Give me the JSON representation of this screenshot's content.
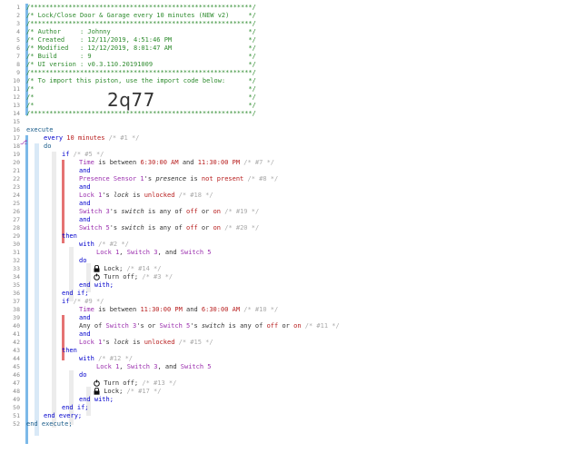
{
  "import_code": "2q77",
  "header_lines": [
    "/**********************************************************/",
    "/* Lock/Close Door & Garage every 10 minutes (NEW v2)     */",
    "/**********************************************************/",
    "/* Author     : Johnny                                    */",
    "/* Created    : 12/11/2019, 4:51:46 PM                    */",
    "/* Modified   : 12/12/2019, 8:01:47 AM                    */",
    "/* Build      : 9                                         */",
    "/* UI version : v0.3.110.20191009                         */",
    "/**********************************************************/",
    "/* To import this piston, use the import code below:      */",
    "/*                                                        */",
    "/*                                                        */",
    "/*                                                        */",
    "/**********************************************************/"
  ],
  "line_numbers": [
    "1",
    "2",
    "3",
    "4",
    "5",
    "6",
    "7",
    "8",
    "9",
    "10",
    "11",
    "12",
    "13",
    "14",
    "15",
    "16",
    "17",
    "18",
    "19",
    "20",
    "21",
    "22",
    "23",
    "24",
    "25",
    "26",
    "27",
    "28",
    "29",
    "30",
    "31",
    "32",
    "33",
    "34",
    "35",
    "36",
    "37",
    "38",
    "39",
    "40",
    "41",
    "42",
    "43",
    "44",
    "45",
    "46",
    "47",
    "48",
    "49",
    "50",
    "51",
    "52"
  ],
  "code": {
    "execute": "execute",
    "every_kw": "every",
    "every_val": "10 minutes",
    "every_cm": "/* #1 */",
    "do": "do",
    "if": "if",
    "if1_cm": "/* #5 */",
    "time_kw": "Time",
    "is_between": "is between",
    "t1a": "6:30:00 AM",
    "and": "and",
    "t1b": "11:30:00 PM",
    "c7": "/* #7 */",
    "presence_dev": "Presence Sensor 1",
    "s_presence": "'s",
    "presence_attr": "presence",
    "is": "is",
    "not_present": "not present",
    "c8": "/* #8 */",
    "lock1_dev": "Lock 1",
    "s_lock": "'s",
    "lock_attr": "lock",
    "unlocked": "unlocked",
    "c18": "/* #18 */",
    "switch3_dev": "Switch 3",
    "switch5_dev": "Switch 5",
    "switch_attr": "switch",
    "is_any_of": "is any of",
    "off": "off",
    "or": "or",
    "on": "on",
    "c19": "/* #19 */",
    "c20": "/* #20 */",
    "then": "then",
    "with": "with",
    "c2": "/* #2 */",
    "comma": ",",
    "and_word": "and",
    "lock_cmd": "Lock;",
    "c14": "/* #14 */",
    "turn_off": "Turn off;",
    "c3": "/* #3 */",
    "end_with": "end with;",
    "end_if": "end if;",
    "if2_cm": "/* #9 */",
    "t2a": "11:30:00 PM",
    "t2b": "6:30:00 AM",
    "c10": "/* #10 */",
    "any_of": "Any of",
    "s_or": "'s or",
    "s_switch": "'s",
    "c11": "/* #11 */",
    "c15": "/* #15 */",
    "c12": "/* #12 */",
    "c13": "/* #13 */",
    "c17": "/* #17 */",
    "end_every": "end every;",
    "end_execute": "end execute;"
  }
}
